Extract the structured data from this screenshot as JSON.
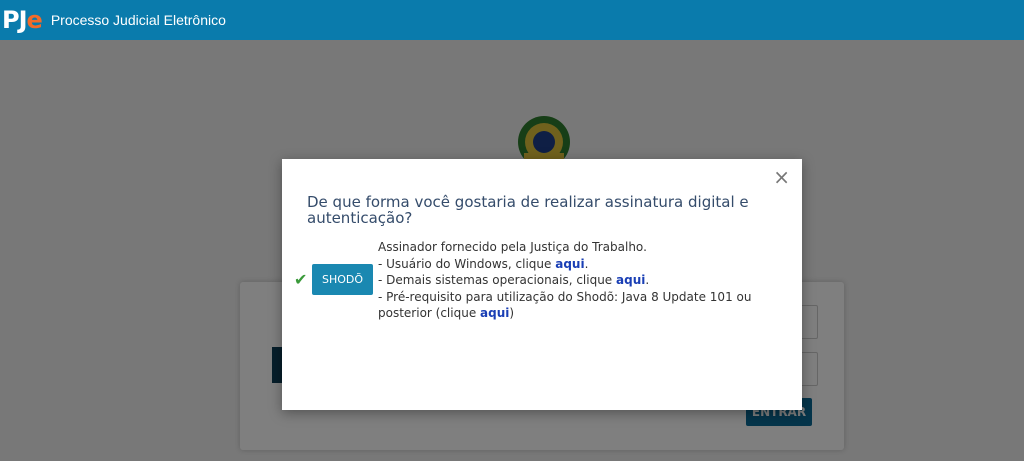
{
  "header": {
    "logo_pj": "PJ",
    "logo_e": "e",
    "app_title": "Processo Judicial Eletrônico",
    "background_color": "#0a7bac"
  },
  "background_login": {
    "enter_label": "ENTRAR"
  },
  "modal": {
    "close_label": "×",
    "heading": "De que forma você gostaria de realizar assinatura digital e autenticação?",
    "option_shodo": {
      "button_label": "SHODÕ",
      "selected": true,
      "line1": "Assinador fornecido pela Justiça do Trabalho.",
      "line2_prefix": "- Usuário do Windows, clique ",
      "line3_prefix": "- Demais sistemas operacionais, clique ",
      "line4_prefix": "- Pré-requisito para utilização do Shodõ: Java 8 Update 101 ou posterior (clique ",
      "link_label": "aqui",
      "period": ".",
      "closing_paren": ")"
    }
  }
}
